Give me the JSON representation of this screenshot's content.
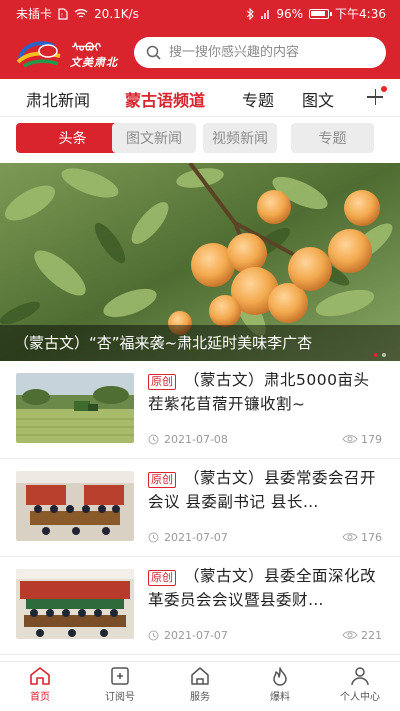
{
  "status_bar": {
    "carrier": "未插卡",
    "speed": "20.1K/s",
    "battery": "96%",
    "time": "下午4:36"
  },
  "header": {
    "logo_text": "文美肃北",
    "logo_mongolian": "ᠰᠤᠪᠤᠢ",
    "search_placeholder": "搜一搜你感兴趣的内容",
    "brand_color": "#d9242e"
  },
  "channel_tabs": [
    {
      "label": "肃北新闻",
      "active": false
    },
    {
      "label": "蒙古语频道",
      "active": true
    },
    {
      "label": "专题",
      "active": false
    },
    {
      "label": "图文",
      "active": false
    }
  ],
  "sub_tabs": [
    {
      "label": "头条",
      "active": true
    },
    {
      "label": "图文新闻",
      "active": false
    },
    {
      "label": "视频新闻",
      "active": false
    },
    {
      "label": "专题",
      "active": false
    }
  ],
  "banner": {
    "caption": "（蒙古文）“杏”福来袭~肃北延时美味李广杏"
  },
  "news": [
    {
      "badge": "原创",
      "title": "（蒙古文）肃北5000亩头茬紫花苜蓿开镰收割~",
      "date": "2021-07-08",
      "views": "179"
    },
    {
      "badge": "原创",
      "title": "（蒙古文）县委常委会召开会议 县委副书记 县长…",
      "date": "2021-07-07",
      "views": "176"
    },
    {
      "badge": "原创",
      "title": "（蒙古文）县委全面深化改革委员会会议暨县委财…",
      "date": "2021-07-07",
      "views": "221"
    }
  ],
  "tabbar": [
    {
      "label": "首页",
      "icon": "home-icon",
      "active": true
    },
    {
      "label": "订阅号",
      "icon": "subscribe-icon",
      "active": false
    },
    {
      "label": "服务",
      "icon": "service-icon",
      "active": false
    },
    {
      "label": "爆料",
      "icon": "fire-icon",
      "active": false
    },
    {
      "label": "个人中心",
      "icon": "user-icon",
      "active": false
    }
  ]
}
